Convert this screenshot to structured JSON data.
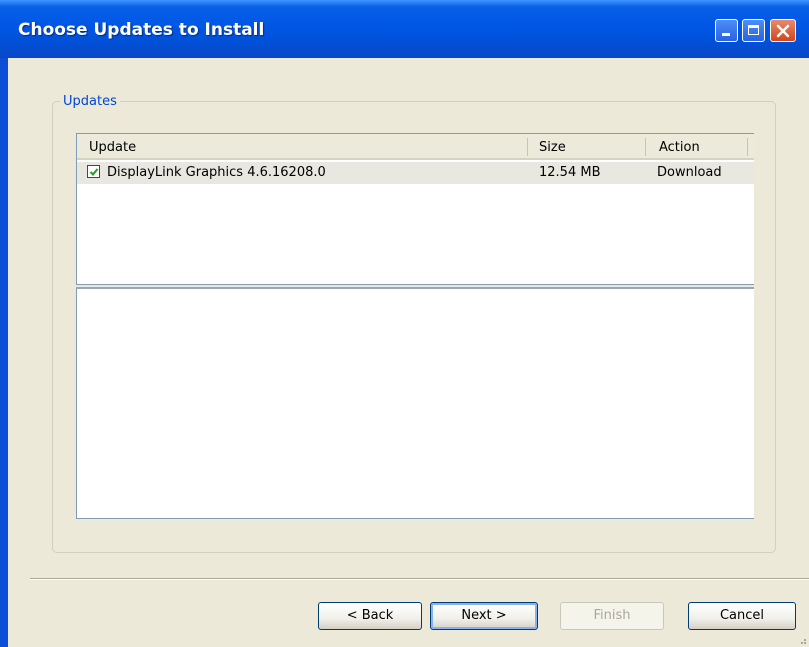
{
  "window": {
    "title": "Choose Updates to Install"
  },
  "group": {
    "label": "Updates"
  },
  "list": {
    "columns": [
      "Update",
      "Size",
      "Action"
    ],
    "rows": [
      {
        "checked": true,
        "name": "DisplayLink Graphics 4.6.16208.0",
        "size": "12.54 MB",
        "action": "Download"
      }
    ]
  },
  "buttons": {
    "back": "< Back",
    "next": "Next >",
    "finish": "Finish",
    "cancel": "Cancel"
  },
  "colors": {
    "titlebar": "#0058e6",
    "client": "#ece9d8",
    "group_label": "#0046d5"
  }
}
